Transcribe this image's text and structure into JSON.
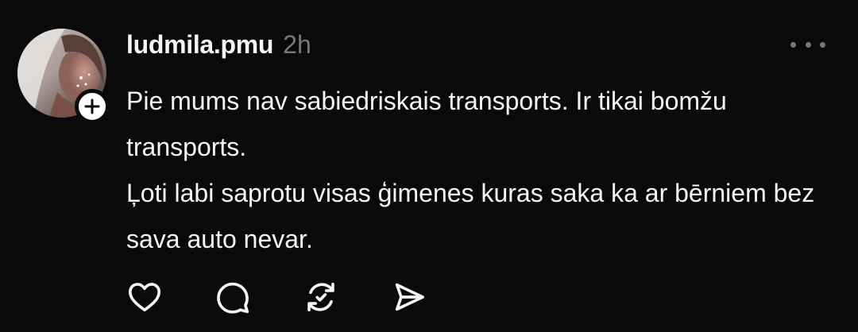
{
  "post": {
    "author": {
      "username": "ludmila.pmu",
      "timestamp": "2h"
    },
    "body": {
      "paragraphs": [
        "Pie mums nav sabiedriskais transports. Ir tikai bomžu transports.",
        "Ļoti labi saprotu visas ģimenes kuras saka ka ar bērniem bez sava auto nevar."
      ]
    },
    "icons": {
      "follow": "plus-icon",
      "more": "more-icon",
      "like": "heart-icon",
      "comment": "comment-icon",
      "repost": "repost-icon",
      "share": "send-icon"
    }
  }
}
